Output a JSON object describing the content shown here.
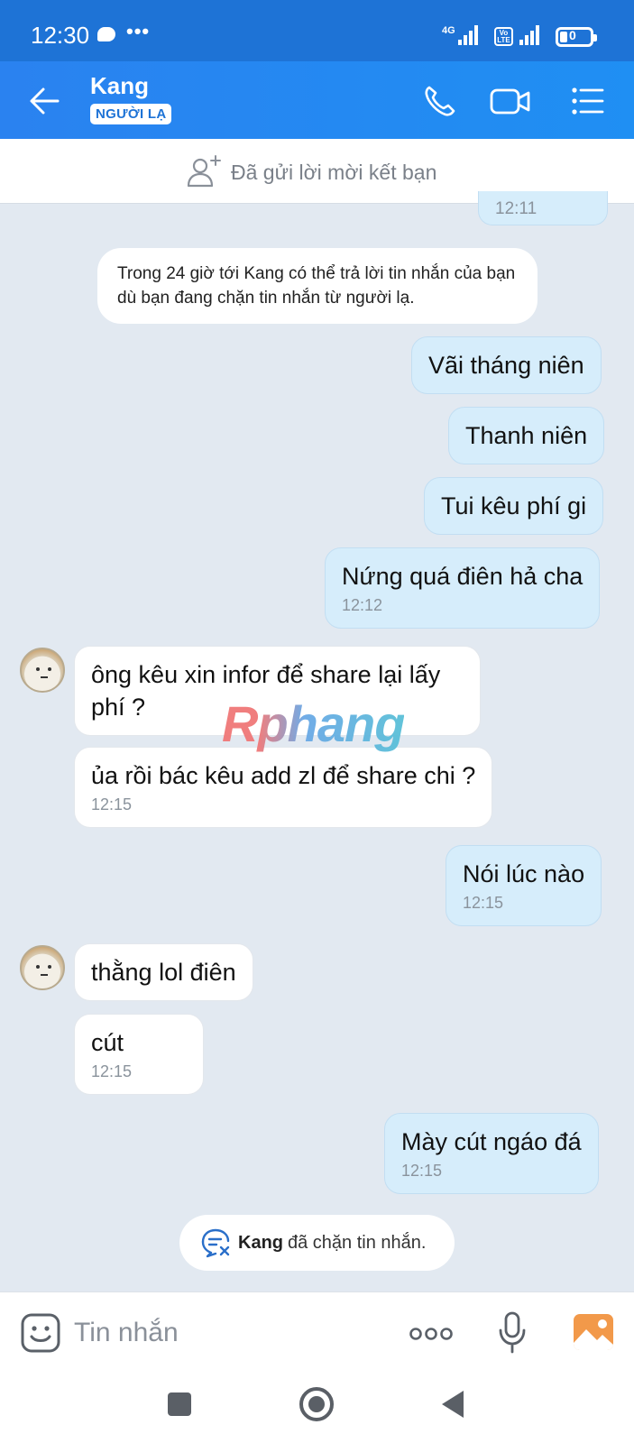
{
  "status_bar": {
    "time": "12:30",
    "signal_1_label": "4G",
    "volte_label": "Vo LTE",
    "battery_level": "0"
  },
  "header": {
    "contact_name": "Kang",
    "badge": "NGƯỜI LẠ",
    "icons": [
      "back-arrow-icon",
      "phone-icon",
      "video-call-icon",
      "menu-icon"
    ]
  },
  "friend_request": {
    "text": "Đã gửi lời mời kết bạn"
  },
  "conversation": {
    "partial_top_time": "12:11",
    "system_note": "Trong 24 giờ tới Kang có thể trả lời tin nhắn của bạn dù bạn đang chặn tin nhắn từ người lạ.",
    "messages": [
      {
        "from": "me",
        "text": "Vãi tháng niên",
        "time": ""
      },
      {
        "from": "me",
        "text": "Thanh niên",
        "time": ""
      },
      {
        "from": "me",
        "text": "Tui kêu phí gi",
        "time": ""
      },
      {
        "from": "me",
        "text": "Nứng quá điên hả cha",
        "time": "12:12"
      },
      {
        "from": "them",
        "text": "ông kêu xin infor để share lại lấy phí ?",
        "time": ""
      },
      {
        "from": "them",
        "text": "ủa rồi bác kêu add zl để share chi ?",
        "time": "12:15"
      },
      {
        "from": "me",
        "text": "Nói lúc nào",
        "time": "12:15"
      },
      {
        "from": "them",
        "text": "thằng lol điên",
        "time": ""
      },
      {
        "from": "them",
        "text": "cút",
        "time": "12:15"
      },
      {
        "from": "me",
        "text": "Mày cút ngáo đá",
        "time": "12:15"
      }
    ],
    "watermark": "Rphang",
    "block_note": {
      "name": "Kang",
      "text": "đã chặn tin nhắn."
    }
  },
  "composer": {
    "placeholder": "Tin nhắn"
  },
  "colors": {
    "header_blue": "#1f8ff3",
    "sent_bubble": "#d6edfb",
    "background": "#e2e9f1"
  }
}
